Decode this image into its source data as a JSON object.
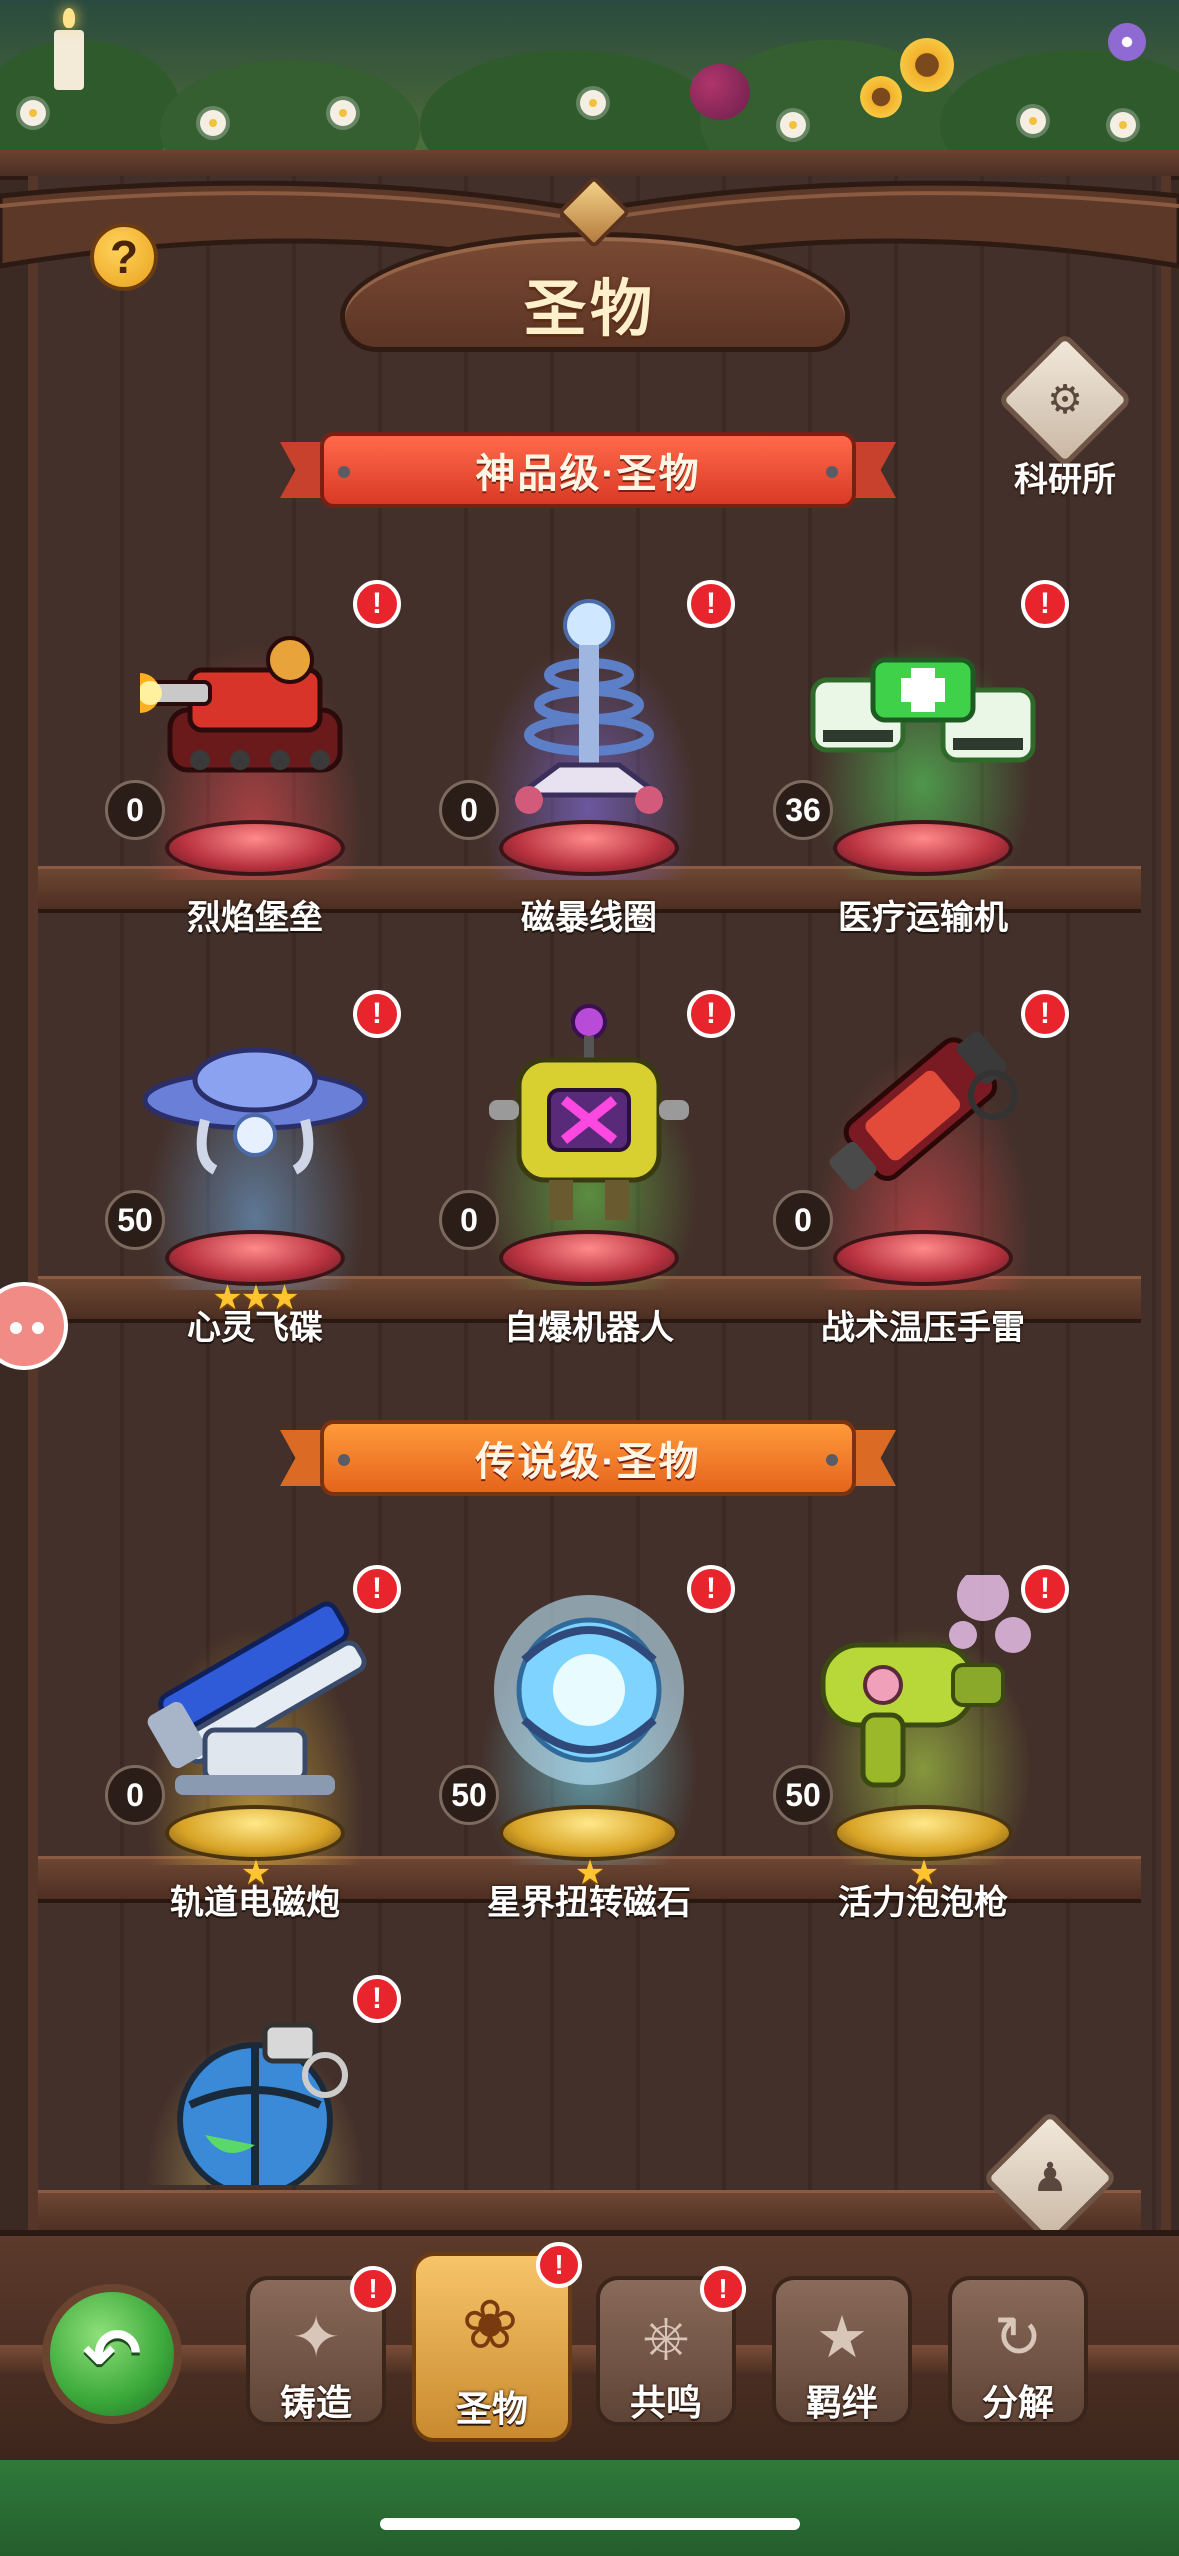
{
  "header": {
    "title": "圣物",
    "help_symbol": "?"
  },
  "side_buttons": {
    "research": "科研所",
    "formation": "布阵"
  },
  "tiers": {
    "divine": "神品级·圣物",
    "legendary": "传说级·圣物"
  },
  "relics_divine": [
    {
      "name": "烈焰堡垒",
      "count": "0",
      "stars": ""
    },
    {
      "name": "磁暴线圈",
      "count": "0",
      "stars": ""
    },
    {
      "name": "医疗运输机",
      "count": "36",
      "stars": ""
    },
    {
      "name": "心灵飞碟",
      "count": "50",
      "stars": "★★★"
    },
    {
      "name": "自爆机器人",
      "count": "0",
      "stars": ""
    },
    {
      "name": "战术温压手雷",
      "count": "0",
      "stars": ""
    }
  ],
  "relics_legendary": [
    {
      "name": "轨道电磁炮",
      "count": "0",
      "stars": "★"
    },
    {
      "name": "星界扭转磁石",
      "count": "50",
      "stars": "★"
    },
    {
      "name": "活力泡泡枪",
      "count": "50",
      "stars": "★"
    },
    {
      "name": "",
      "count": "",
      "stars": ""
    }
  ],
  "alert_symbol": "!",
  "bottom_tabs": [
    {
      "label": "铸造",
      "icon": "forge-icon",
      "active": false,
      "alert": true
    },
    {
      "label": "圣物",
      "icon": "relic-icon",
      "active": true,
      "alert": true
    },
    {
      "label": "共鸣",
      "icon": "resonance-icon",
      "active": false,
      "alert": true
    },
    {
      "label": "羁绊",
      "icon": "bond-icon",
      "active": false,
      "alert": false
    },
    {
      "label": "分解",
      "icon": "decompose-icon",
      "active": false,
      "alert": false
    }
  ],
  "colors": {
    "alert": "#e8242c",
    "divine_banner": "#d93a26",
    "legendary_banner": "#e5641c",
    "star": "#ffc531"
  }
}
